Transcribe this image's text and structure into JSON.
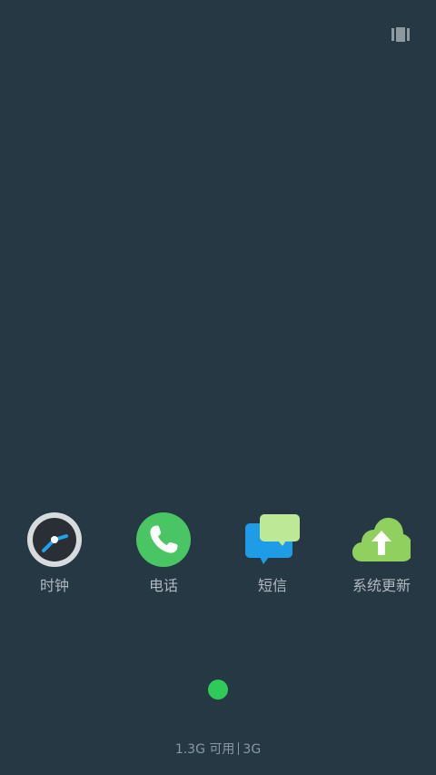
{
  "top_bar": {
    "recents_icon": "recents-icon"
  },
  "apps": [
    {
      "label": "时钟",
      "icon": "clock-icon"
    },
    {
      "label": "电话",
      "icon": "phone-icon"
    },
    {
      "label": "短信",
      "icon": "messages-icon"
    },
    {
      "label": "系统更新",
      "icon": "system-update-icon"
    }
  ],
  "status": {
    "memory": "1.3G 可用",
    "network": "3G"
  },
  "colors": {
    "background": "#273845",
    "page_indicator": "#2ecc57"
  }
}
